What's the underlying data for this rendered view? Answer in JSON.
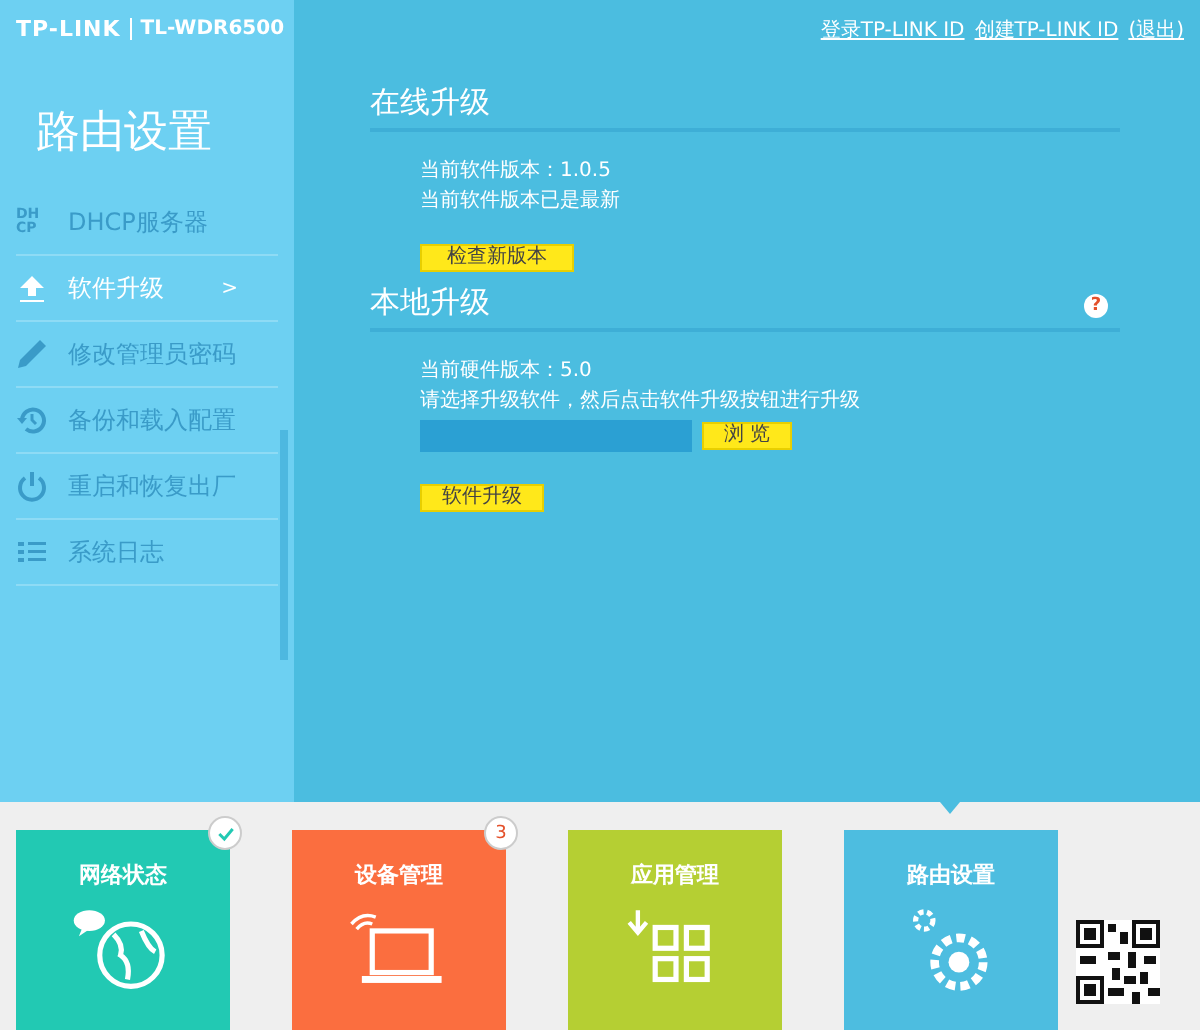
{
  "header": {
    "logo": "TP-LINK",
    "model": "TL-WDR6500",
    "links": [
      "登录TP-LINK ID",
      "创建TP-LINK ID",
      "(退出)"
    ]
  },
  "sidebar": {
    "title": "路由设置",
    "items": [
      {
        "label": "DHCP服务器",
        "icon_text": "DHCP",
        "selected": false
      },
      {
        "label": "软件升级",
        "selected": true,
        "arrow": ">"
      },
      {
        "label": "修改管理员密码",
        "selected": false
      },
      {
        "label": "备份和载入配置",
        "selected": false
      },
      {
        "label": "重启和恢复出厂",
        "selected": false
      },
      {
        "label": "系统日志",
        "selected": false
      }
    ]
  },
  "online_upgrade": {
    "title": "在线升级",
    "lines": [
      "当前软件版本：1.0.5",
      "当前软件版本已是最新"
    ],
    "button": "检查新版本"
  },
  "local_upgrade": {
    "title": "本地升级",
    "help": "?",
    "lines": [
      "当前硬件版本：5.0",
      "请选择升级软件，然后点击软件升级按钮进行升级"
    ],
    "browse_button": "浏 览",
    "upgrade_button": "软件升级"
  },
  "tiles": [
    {
      "label": "网络状态",
      "color": "#22c9b3",
      "selected": false,
      "kind": "check"
    },
    {
      "label": "设备管理",
      "color": "#fb6e3f",
      "selected": false,
      "kind": "count",
      "badge": "3"
    },
    {
      "label": "应用管理",
      "color": "#b5cf33",
      "selected": false
    },
    {
      "label": "路由设置",
      "color": "#4dbde0",
      "selected": true
    }
  ]
}
